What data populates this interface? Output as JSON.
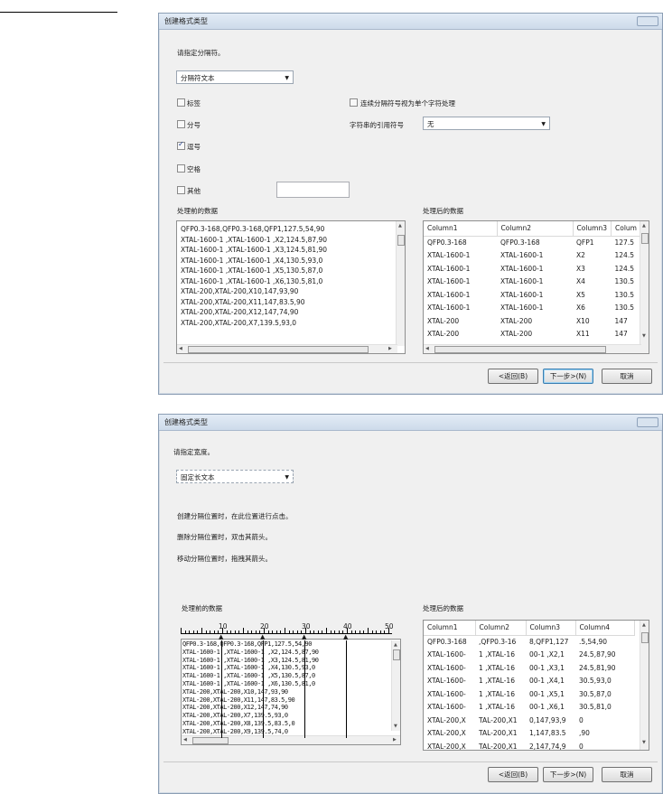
{
  "dialog1": {
    "title": "创建格式类型",
    "instruction": "请指定分隔符。",
    "mode_combo": "分隔符文本",
    "checkboxes": [
      {
        "label": "标签",
        "checked": false
      },
      {
        "label": "分号",
        "checked": false
      },
      {
        "label": "逗号",
        "checked": true
      },
      {
        "label": "空格",
        "checked": false
      },
      {
        "label": "其他",
        "checked": false
      }
    ],
    "consecutive_label": "连续分隔符号视为单个字符处理",
    "text_qualifier_label": "字符串的引用符号",
    "text_qualifier_value": "无",
    "preview_before_label": "处理前的数据",
    "preview_after_label": "处理后的数据",
    "before_lines": [
      "QFP0.3-168,QFP0.3-168,QFP1,127.5,54,90",
      "XTAL-1600-1 ,XTAL-1600-1 ,X2,124.5,87,90",
      "XTAL-1600-1 ,XTAL-1600-1 ,X3,124.5,81,90",
      "XTAL-1600-1 ,XTAL-1600-1 ,X4,130.5,93,0",
      "XTAL-1600-1 ,XTAL-1600-1 ,X5,130.5,87,0",
      "XTAL-1600-1 ,XTAL-1600-1 ,X6,130.5,81,0",
      "XTAL-200,XTAL-200,X10,147,93,90",
      "XTAL-200,XTAL-200,X11,147,83.5,90",
      "XTAL-200,XTAL-200,X12,147,74,90",
      "XTAL-200,XTAL-200,X7,139.5,93,0"
    ],
    "after_headers": [
      "Column1",
      "Column2",
      "Column3",
      "Colum"
    ],
    "after_rows": [
      [
        "QFP0.3-168",
        "QFP0.3-168",
        "QFP1",
        "127.5"
      ],
      [
        "XTAL-1600-1",
        "XTAL-1600-1",
        "X2",
        "124.5"
      ],
      [
        "XTAL-1600-1",
        "XTAL-1600-1",
        "X3",
        "124.5"
      ],
      [
        "XTAL-1600-1",
        "XTAL-1600-1",
        "X4",
        "130.5"
      ],
      [
        "XTAL-1600-1",
        "XTAL-1600-1",
        "X5",
        "130.5"
      ],
      [
        "XTAL-1600-1",
        "XTAL-1600-1",
        "X6",
        "130.5"
      ],
      [
        "XTAL-200",
        "XTAL-200",
        "X10",
        "147"
      ],
      [
        "XTAL-200",
        "XTAL-200",
        "X11",
        "147"
      ]
    ],
    "btn_back": "<返回(B)",
    "btn_next": "下一步>(N)",
    "btn_cancel": "取消"
  },
  "dialog2": {
    "title": "创建格式类型",
    "instruction": "请指定宽度。",
    "mode_combo": "固定长文本",
    "hint1": "创建分隔位置时，在此位置进行点击。",
    "hint2": "删除分隔位置时，双击其箭头。",
    "hint3": "移动分隔位置时，拖拽其箭头。",
    "preview_before_label": "处理前的数据",
    "preview_after_label": "处理后的数据",
    "ruler_numbers": [
      "10",
      "20",
      "30",
      "40",
      "50"
    ],
    "before_lines": [
      "QFP0.3-168,QFP0.3-168,QFP1,127.5,54,90",
      "XTAL-1600-1 ,XTAL-1600-1 ,X2,124.5,87,90",
      "XTAL-1600-1 ,XTAL-1600-1 ,X3,124.5,81,90",
      "XTAL-1600-1 ,XTAL-1600-1 ,X4,130.5,93,0",
      "XTAL-1600-1 ,XTAL-1600-1 ,X5,130.5,87,0",
      "XTAL-1600-1 ,XTAL-1600-1 ,X6,130.5,81,0",
      "XTAL-200,XTAL-200,X10,147,93,90",
      "XTAL-200,XTAL-200,X11,147,83.5,90",
      "XTAL-200,XTAL-200,X12,147,74,90",
      "XTAL-200,XTAL-200,X7,139.5,93,0",
      "XTAL-200,XTAL-200,X8,139.5,83.5,0",
      "XTAL-200,XTAL-200,X9,139.5,74,0"
    ],
    "after_headers": [
      "Column1",
      "Column2",
      "Column3",
      "Column4"
    ],
    "after_rows": [
      [
        "QFP0.3-168",
        ",QFP0.3-16",
        "8,QFP1,127",
        ".5,54,90"
      ],
      [
        "XTAL-1600-",
        "1 ,XTAL-16",
        "00-1 ,X2,1",
        "24.5,87,90"
      ],
      [
        "XTAL-1600-",
        "1 ,XTAL-16",
        "00-1 ,X3,1",
        "24.5,81,90"
      ],
      [
        "XTAL-1600-",
        "1 ,XTAL-16",
        "00-1 ,X4,1",
        "30.5,93,0"
      ],
      [
        "XTAL-1600-",
        "1 ,XTAL-16",
        "00-1 ,X5,1",
        "30.5,87,0"
      ],
      [
        "XTAL-1600-",
        "1 ,XTAL-16",
        "00-1 ,X6,1",
        "30.5,81,0"
      ],
      [
        "XTAL-200,X",
        "TAL-200,X1",
        "0,147,93,9",
        "0"
      ],
      [
        "XTAL-200,X",
        "TAL-200,X1",
        "1,147,83.5",
        ",90"
      ],
      [
        "XTAL-200,X",
        "TAL-200,X1",
        "2,147,74,9",
        "0"
      ]
    ],
    "btn_back": "<返回(B)",
    "btn_next": "下一步>(N)",
    "btn_cancel": "取消"
  }
}
